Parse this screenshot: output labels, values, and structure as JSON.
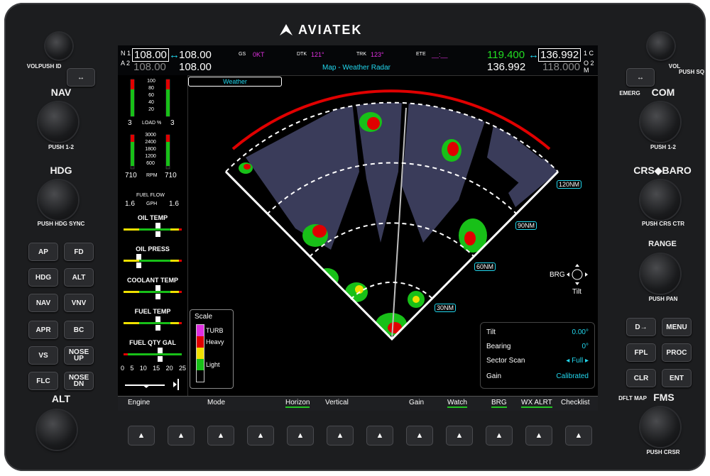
{
  "brand": "AVIATEK",
  "left_panel": {
    "vol_label": "VOL",
    "push_id_label": "PUSH ID",
    "nav_label": "NAV",
    "push_12_label": "PUSH 1-2",
    "hdg_label": "HDG",
    "push_hdg_sync_label": "PUSH HDG SYNC",
    "alt_label": "ALT",
    "buttons": [
      "AP",
      "FD",
      "HDG",
      "ALT",
      "NAV",
      "VNV",
      "APR",
      "BC",
      "VS",
      "NOSE UP",
      "FLC",
      "NOSE DN"
    ]
  },
  "right_panel": {
    "vol_label": "VOL",
    "push_sq_label": "PUSH SQ",
    "emerg_label": "EMERG",
    "com_label": "COM",
    "push_12_label": "PUSH 1-2",
    "crs_baro_label": "CRS◆BARO",
    "push_crs_ctr_label": "PUSH CRS CTR",
    "range_label": "RANGE",
    "push_pan_label": "PUSH PAN",
    "fms_label": "FMS",
    "dflt_map_label": "DFLT MAP",
    "push_crsr_label": "PUSH CRSR",
    "buttons": [
      "D→",
      "MENU",
      "FPL",
      "PROC",
      "CLR",
      "ENT"
    ]
  },
  "top_bar": {
    "nav_tag_1": "N 1",
    "nav_tag_2": "A 2",
    "nav1_active": "108.00",
    "nav1_standby": "108.00",
    "nav2_active": "108.00",
    "nav2_standby": "108.00",
    "gs_label": "GS",
    "gs_value": "0KT",
    "dtk_label": "DTK",
    "dtk_value": "121°",
    "trk_label": "TRK",
    "trk_value": "123°",
    "ete_label": "ETE",
    "ete_value": "__:__",
    "page_title": "Map - Weather Radar",
    "com1_active": "119.400",
    "com1_standby": "136.992",
    "com2_active": "136.992",
    "com2_standby": "118.000",
    "com_tag_1": "1 C",
    "com_tag_2": "O 2 M"
  },
  "eis": {
    "load_scale": [
      "100",
      "80",
      "60",
      "40",
      "20"
    ],
    "load_label": "LOAD %",
    "load_left": "3",
    "load_right": "3",
    "rpm_scale": [
      "3000",
      "2400",
      "1800",
      "1200",
      "600"
    ],
    "rpm_label": "RPM",
    "rpm_left": "710",
    "rpm_right": "710",
    "fuel_flow_label": "FUEL FLOW",
    "gph_label": "GPH",
    "ff_left": "1.6",
    "ff_right": "1.6",
    "oil_temp_label": "OIL TEMP",
    "oil_press_label": "OIL PRESS",
    "coolant_temp_label": "COOLANT TEMP",
    "fuel_temp_label": "FUEL TEMP",
    "fuel_qty_label": "FUEL QTY GAL",
    "fuel_qty_scale": [
      "0",
      "5",
      "10",
      "15",
      "20",
      "25"
    ]
  },
  "map": {
    "tab_label": "Weather",
    "range_labels": [
      "30NM",
      "60NM",
      "90NM",
      "120NM"
    ],
    "brg_label": "BRG",
    "tilt_label": "Tilt"
  },
  "scale_legend": {
    "title": "Scale",
    "items": [
      {
        "label": "TURB",
        "color": "#e030e0"
      },
      {
        "label": "Heavy",
        "color": "#e00000"
      },
      {
        "label": "",
        "color": "#f0e000"
      },
      {
        "label": "Light",
        "color": "#18c018"
      },
      {
        "label": "",
        "color": "#000000"
      }
    ]
  },
  "info_box": {
    "rows": [
      {
        "label": "Tilt",
        "value": "0.00°"
      },
      {
        "label": "Bearing",
        "value": "0°"
      },
      {
        "label": "Sector Scan",
        "value": "◂ Full ▸"
      },
      {
        "label": "Gain",
        "value": "Calibrated"
      }
    ]
  },
  "softkeys": [
    "Engine",
    "",
    "Mode",
    "",
    "Horizon",
    "Vertical",
    "",
    "Gain",
    "Watch",
    "BRG",
    "WX ALRT",
    "Checklist"
  ],
  "softkeys_active": [
    "Horizon",
    "Watch",
    "BRG",
    "WX ALRT"
  ]
}
